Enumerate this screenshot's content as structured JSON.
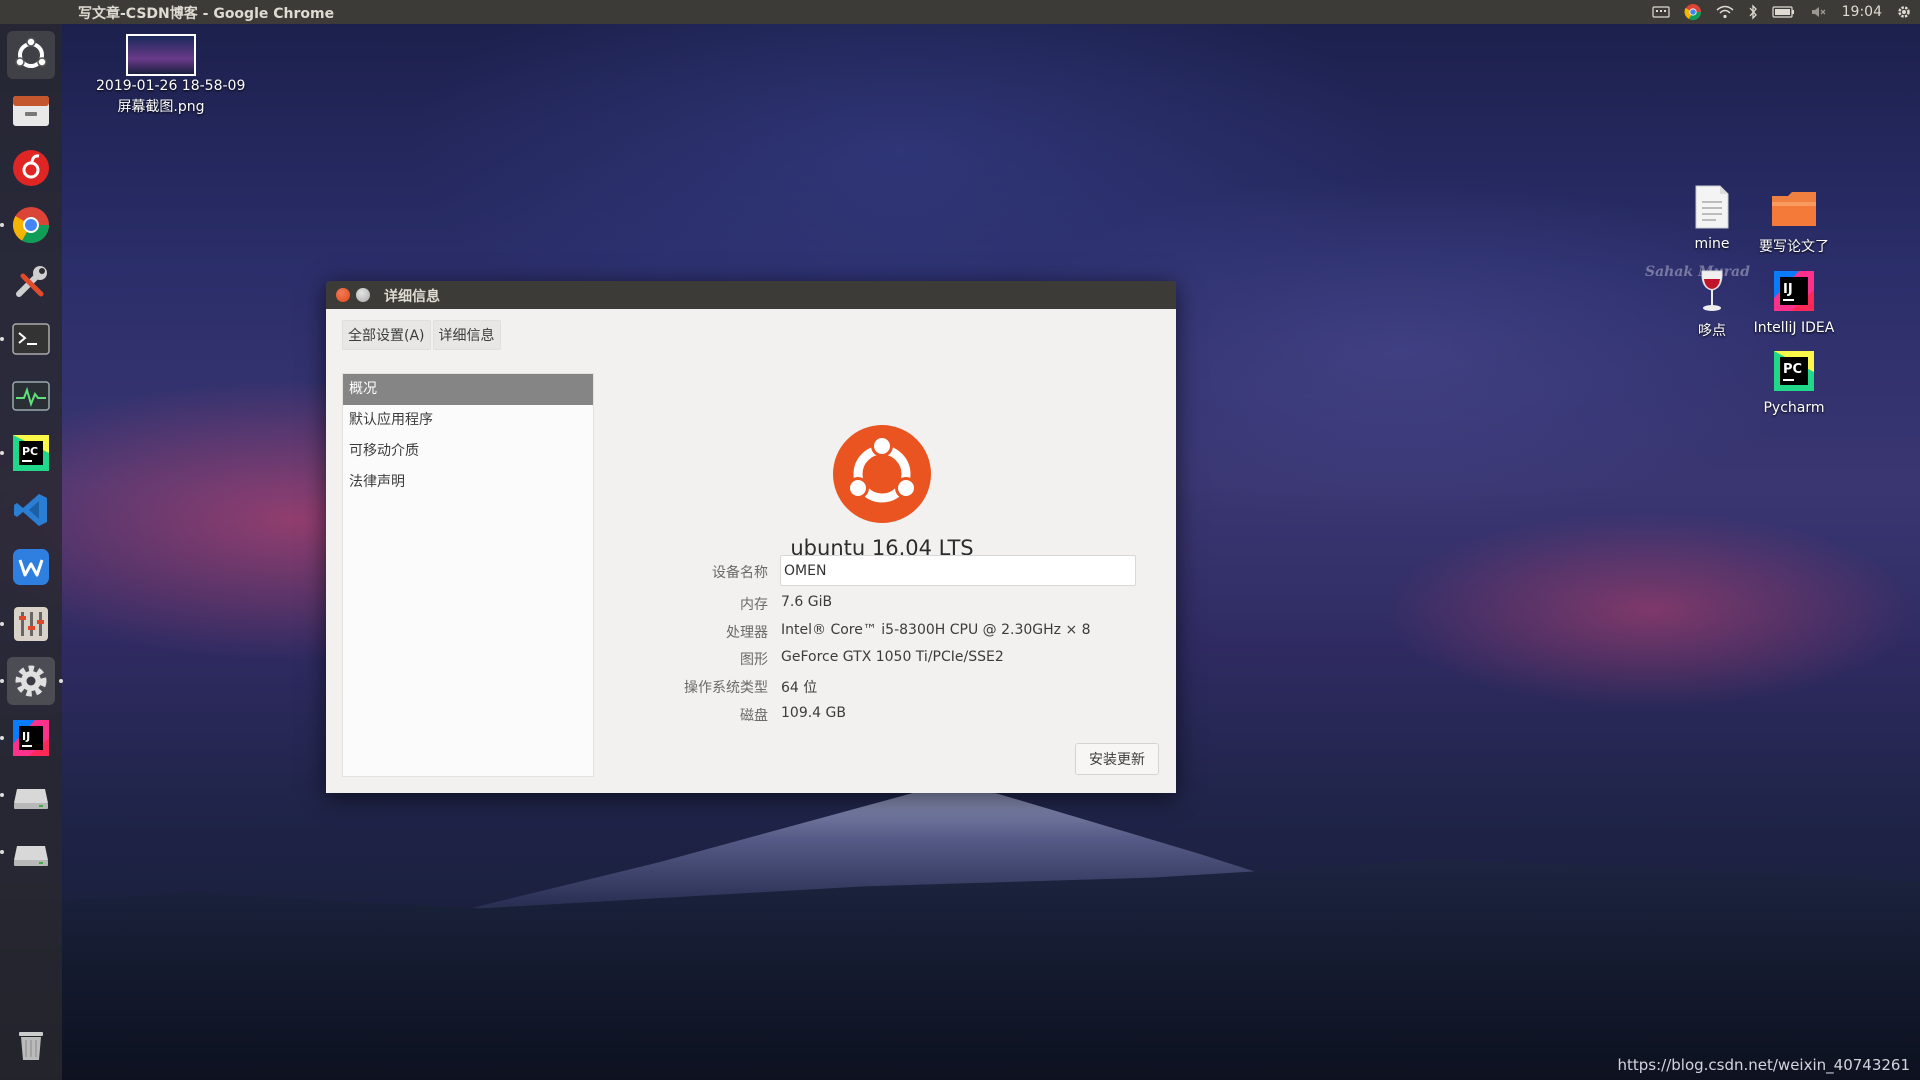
{
  "top_panel": {
    "title": "写文章-CSDN博客 - Google Chrome",
    "clock": "19:04"
  },
  "launcher": {
    "items": [
      {
        "name": "ubuntu-dash",
        "icon": "ubuntu-logo-icon"
      },
      {
        "name": "files",
        "icon": "file-manager-icon"
      },
      {
        "name": "netease-music",
        "icon": "netease-music-icon"
      },
      {
        "name": "chrome",
        "icon": "chrome-icon"
      },
      {
        "name": "system-tools",
        "icon": "wrench-screwdriver-icon"
      },
      {
        "name": "terminal",
        "icon": "terminal-icon"
      },
      {
        "name": "system-monitor",
        "icon": "system-monitor-icon"
      },
      {
        "name": "pycharm",
        "icon": "pycharm-icon"
      },
      {
        "name": "vscode",
        "icon": "vscode-icon"
      },
      {
        "name": "wps",
        "icon": "wps-icon"
      },
      {
        "name": "mixer",
        "icon": "sliders-icon"
      },
      {
        "name": "settings",
        "icon": "gear-icon"
      },
      {
        "name": "intellij",
        "icon": "intellij-icon"
      },
      {
        "name": "drive-1",
        "icon": "drive-icon"
      },
      {
        "name": "drive-2",
        "icon": "drive-icon"
      },
      {
        "name": "trash",
        "icon": "trash-icon"
      }
    ]
  },
  "desktop": {
    "screenshot_file": {
      "line1": "2019-01-26 18-58-09",
      "line2": "屏幕截图.png"
    },
    "mine": "mine",
    "thesis_folder": "要写论文了",
    "duodian": "哆点",
    "intellij": "IntelliJ IDEA",
    "pycharm": "Pycharm"
  },
  "window": {
    "title": "详细信息",
    "breadcrumb": [
      "全部设置(A)",
      "详细信息"
    ],
    "sidebar": [
      "概况",
      "默认应用程序",
      "可移动介质",
      "法律声明"
    ],
    "selected_index": 0,
    "os_name": "ubuntu 16.04 LTS",
    "device_name_label": "设备名称",
    "device_name_value": "OMEN",
    "memory_label": "内存",
    "memory_value": "7.6 GiB",
    "processor_label": "处理器",
    "processor_value": "Intel® Core™ i5-8300H CPU @ 2.30GHz × 8",
    "graphics_label": "图形",
    "graphics_value": "GeForce GTX 1050 Ti/PCIe/SSE2",
    "os_type_label": "操作系统类型",
    "os_type_value": "64 位",
    "disk_label": "磁盘",
    "disk_value": "109.4 GB",
    "install_button": "安装更新"
  },
  "watermark": {
    "url": "https://blog.csdn.net/weixin_40743261",
    "logo": "Sahak Murad"
  },
  "colors": {
    "ubuntu_orange": "#e95420",
    "panel_bg": "#3c3b37",
    "selected_row": "#858585"
  }
}
